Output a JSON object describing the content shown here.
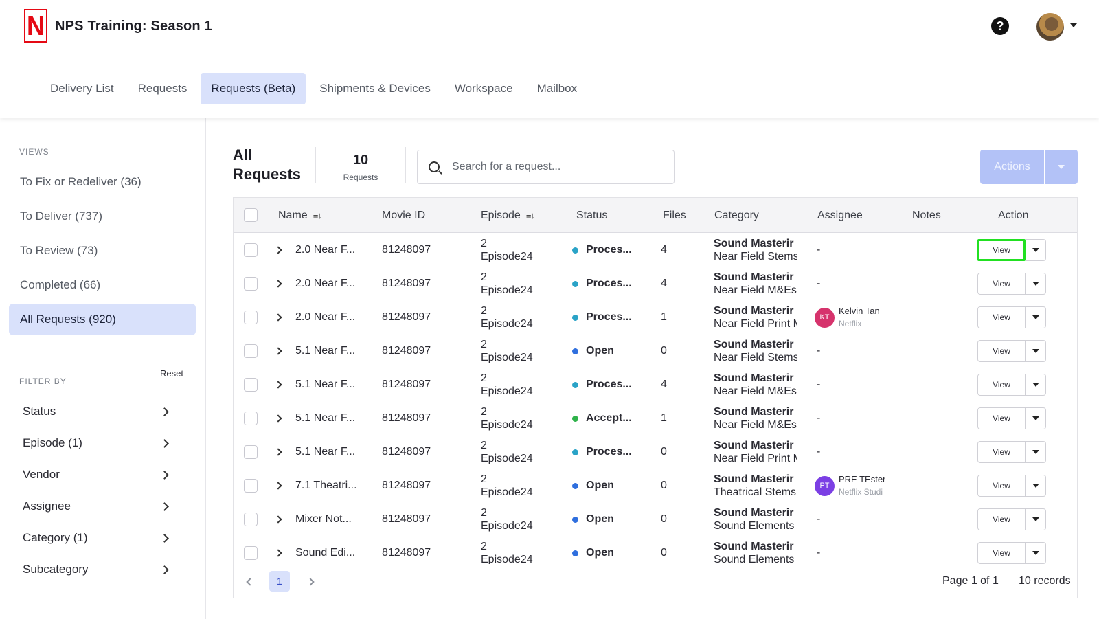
{
  "app": {
    "title": "NPS Training: Season 1",
    "logo_letter": "N",
    "help_glyph": "?"
  },
  "nav": {
    "tabs": [
      {
        "label": "Delivery List"
      },
      {
        "label": "Requests"
      },
      {
        "label": "Requests (Beta)",
        "active": true
      },
      {
        "label": "Shipments & Devices"
      },
      {
        "label": "Workspace"
      },
      {
        "label": "Mailbox"
      }
    ]
  },
  "sidebar": {
    "views_label": "VIEWS",
    "views": [
      {
        "label": "To Fix or Redeliver (36)"
      },
      {
        "label": "To Deliver (737)"
      },
      {
        "label": "To Review (73)"
      },
      {
        "label": "Completed (66)"
      },
      {
        "label": "All Requests (920)",
        "active": true
      }
    ],
    "filter_label": "FILTER BY",
    "reset_label": "Reset",
    "filters": [
      {
        "label": "Status"
      },
      {
        "label": "Episode (1)"
      },
      {
        "label": "Vendor"
      },
      {
        "label": "Assignee"
      },
      {
        "label": "Category (1)"
      },
      {
        "label": "Subcategory"
      }
    ]
  },
  "main": {
    "title_line1": "All",
    "title_line2": "Requests",
    "count_value": "10",
    "count_label": "Requests",
    "search_placeholder": "Search for a request...",
    "actions_label": "Actions"
  },
  "table": {
    "columns": {
      "name": "Name",
      "movie_id": "Movie ID",
      "episode": "Episode",
      "status": "Status",
      "files": "Files",
      "category": "Category",
      "assignee": "Assignee",
      "notes": "Notes",
      "action": "Action"
    },
    "view_label": "View",
    "status_colors": {
      "processing": "#2aa3c7",
      "open": "#2f6fde",
      "accepted": "#2fb24a"
    },
    "rows": [
      {
        "name": "2.0 Near F...",
        "movie_id": "81248097",
        "episode_num": "2",
        "episode_name": "Episode24",
        "status": "Proces...",
        "status_kind": "processing",
        "files": "4",
        "category": "Sound Masterir",
        "subcategory": "Near Field Stems",
        "assignee": "-",
        "highlight": true
      },
      {
        "name": "2.0 Near F...",
        "movie_id": "81248097",
        "episode_num": "2",
        "episode_name": "Episode24",
        "status": "Proces...",
        "status_kind": "processing",
        "files": "4",
        "category": "Sound Masterir",
        "subcategory": "Near Field M&Es",
        "assignee": "-"
      },
      {
        "name": "2.0 Near F...",
        "movie_id": "81248097",
        "episode_num": "2",
        "episode_name": "Episode24",
        "status": "Proces...",
        "status_kind": "processing",
        "files": "1",
        "category": "Sound Masterir",
        "subcategory": "Near Field Print M",
        "assignee": "",
        "assignee_initials": "KT",
        "assignee_name": "Kelvin Tan",
        "assignee_org": "Netflix",
        "assignee_color": "#d6336c"
      },
      {
        "name": "5.1 Near F...",
        "movie_id": "81248097",
        "episode_num": "2",
        "episode_name": "Episode24",
        "status": "Open",
        "status_kind": "open",
        "files": "0",
        "category": "Sound Masterir",
        "subcategory": "Near Field Stems",
        "assignee": "-"
      },
      {
        "name": "5.1 Near F...",
        "movie_id": "81248097",
        "episode_num": "2",
        "episode_name": "Episode24",
        "status": "Proces...",
        "status_kind": "processing",
        "files": "4",
        "category": "Sound Masterir",
        "subcategory": "Near Field M&Es",
        "assignee": "-"
      },
      {
        "name": "5.1 Near F...",
        "movie_id": "81248097",
        "episode_num": "2",
        "episode_name": "Episode24",
        "status": "Accept...",
        "status_kind": "accepted",
        "files": "1",
        "category": "Sound Masterir",
        "subcategory": "Near Field M&Es",
        "assignee": "-"
      },
      {
        "name": "5.1 Near F...",
        "movie_id": "81248097",
        "episode_num": "2",
        "episode_name": "Episode24",
        "status": "Proces...",
        "status_kind": "processing",
        "files": "0",
        "category": "Sound Masterir",
        "subcategory": "Near Field Print M",
        "assignee": "-"
      },
      {
        "name": "7.1 Theatri...",
        "movie_id": "81248097",
        "episode_num": "2",
        "episode_name": "Episode24",
        "status": "Open",
        "status_kind": "open",
        "files": "0",
        "category": "Sound Masterir",
        "subcategory": "Theatrical Stems",
        "assignee": "",
        "assignee_initials": "PT",
        "assignee_name": "PRE TEster",
        "assignee_org": "Netflix Studi",
        "assignee_color": "#7b3fe4"
      },
      {
        "name": "Mixer Not...",
        "movie_id": "81248097",
        "episode_num": "2",
        "episode_name": "Episode24",
        "status": "Open",
        "status_kind": "open",
        "files": "0",
        "category": "Sound Masterir",
        "subcategory": "Sound Elements",
        "assignee": "-"
      },
      {
        "name": "Sound Edi...",
        "movie_id": "81248097",
        "episode_num": "2",
        "episode_name": "Episode24",
        "status": "Open",
        "status_kind": "open",
        "files": "0",
        "category": "Sound Masterir",
        "subcategory": "Sound Elements",
        "assignee": "-"
      }
    ]
  },
  "pager": {
    "current_page": "1",
    "page_info": "Page 1 of 1",
    "records": "10 records"
  }
}
